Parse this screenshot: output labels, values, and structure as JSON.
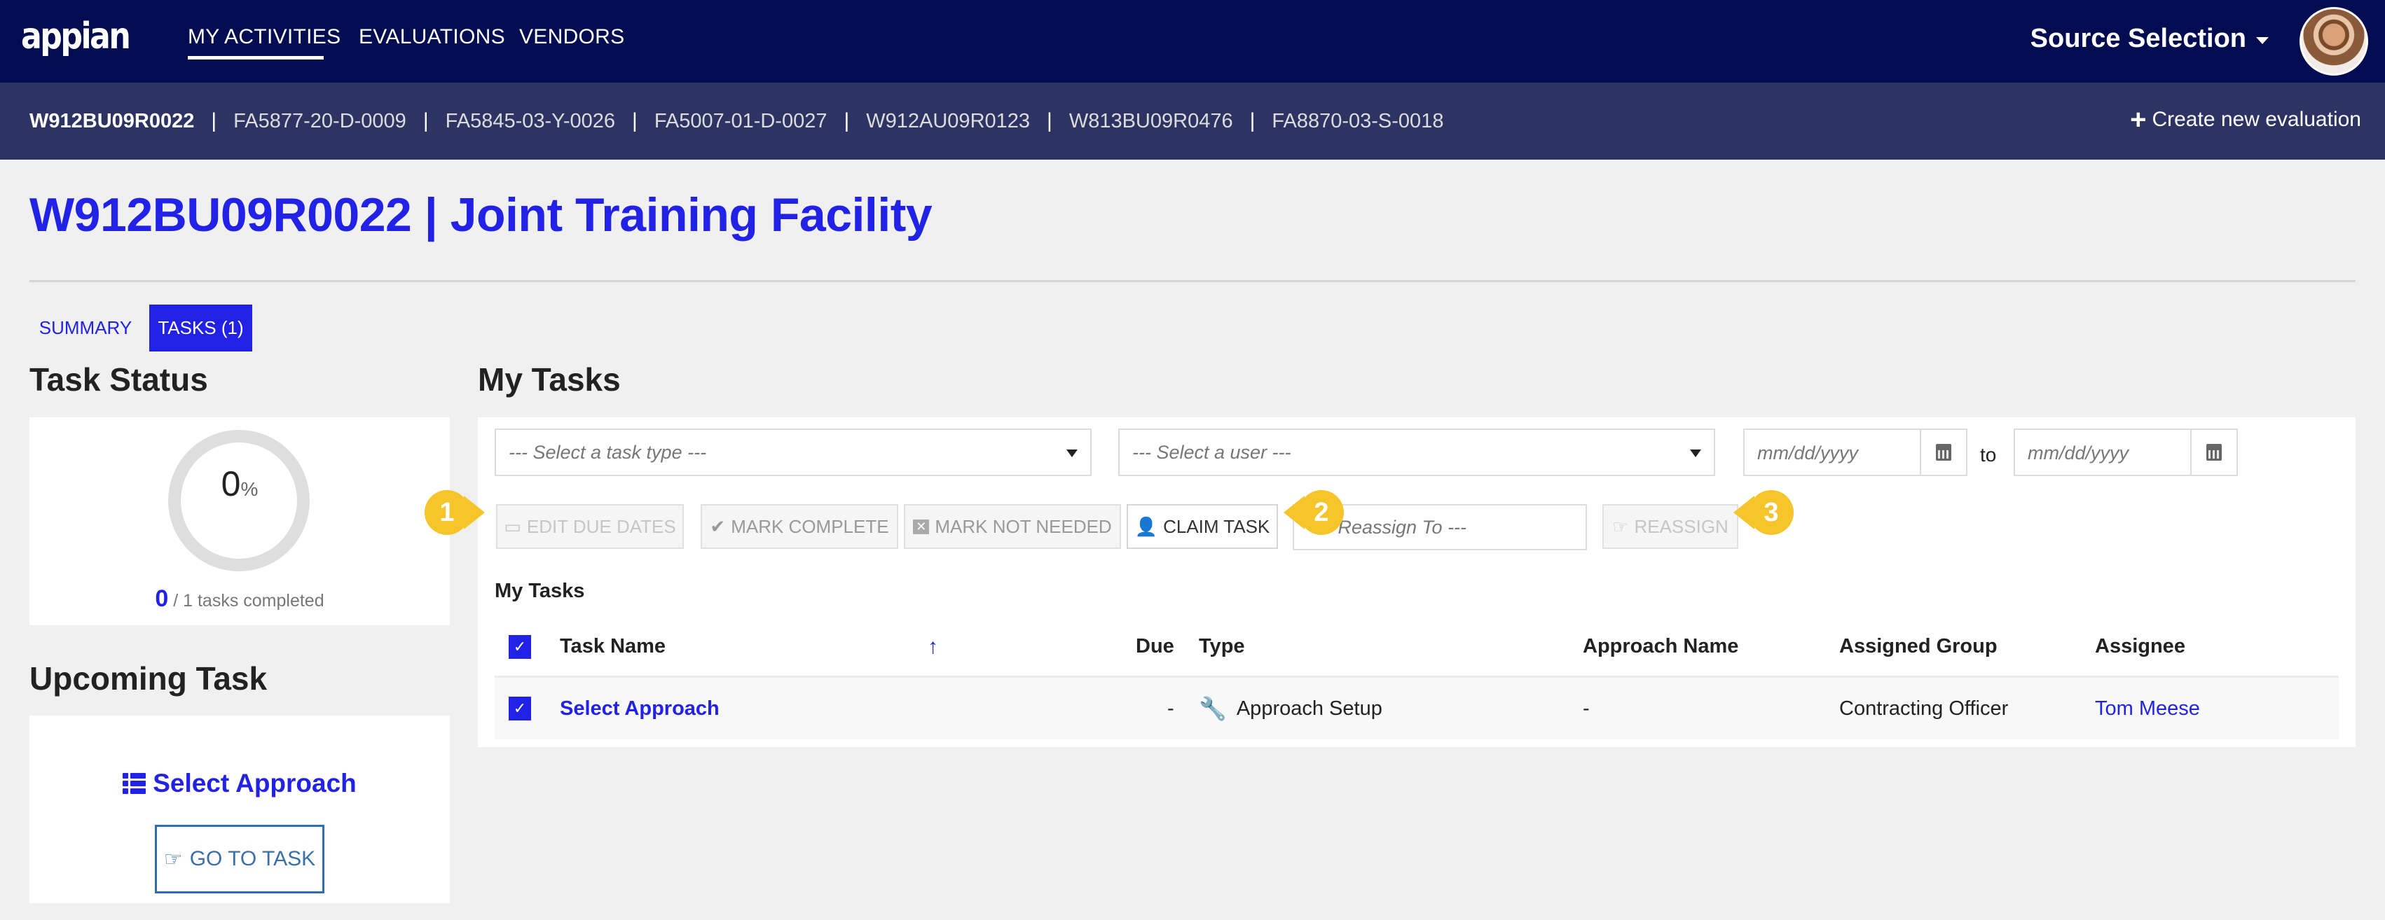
{
  "topnav": {
    "logo": "appian",
    "links": [
      "MY ACTIVITIES",
      "EVALUATIONS",
      "VENDORS"
    ],
    "active_link": "MY ACTIVITIES",
    "app_switcher": "Source Selection",
    "avatar_alt": "user-avatar"
  },
  "subnav": {
    "evaluations": [
      "W912BU09R0022",
      "FA5877-20-D-0009",
      "FA5845-03-Y-0026",
      "FA5007-01-D-0027",
      "W912AU09R0123",
      "W813BU09R0476",
      "FA8870-03-S-0018"
    ],
    "current": "W912BU09R0022",
    "separator": "|",
    "create_new": "Create new evaluation"
  },
  "page": {
    "title": "W912BU09R0022 | Joint Training Facility",
    "tabs": [
      {
        "label": "SUMMARY",
        "active": false
      },
      {
        "label": "TASKS (1)",
        "active": true
      }
    ]
  },
  "task_status": {
    "heading": "Task Status",
    "percent_value": "0",
    "percent_sign": "%",
    "progress_fraction": 0,
    "completed": "0",
    "caption": "/ 1 tasks completed"
  },
  "upcoming_task": {
    "heading": "Upcoming Task",
    "task_name": "Select Approach",
    "go_button": "GO TO TASK"
  },
  "my_tasks": {
    "heading": "My Tasks",
    "filters": {
      "task_type_placeholder": "--- Select a task type ---",
      "user_placeholder": "--- Select a user ---",
      "date_from_placeholder": "mm/dd/yyyy",
      "date_to_placeholder": "mm/dd/yyyy",
      "to_label": "to"
    },
    "actions": {
      "edit_due_dates": "EDIT DUE DATES",
      "mark_complete": "MARK COMPLETE",
      "mark_not_needed": "MARK NOT NEEDED",
      "claim_task": "CLAIM TASK",
      "reassign_placeholder": "--- Reassign To ---",
      "reassign": "REASSIGN"
    },
    "callouts": [
      "1",
      "2",
      "3"
    ],
    "table": {
      "caption": "My Tasks",
      "columns": [
        "Task Name",
        "Due",
        "Type",
        "Approach Name",
        "Assigned Group",
        "Assignee"
      ],
      "sort_indicator": "↑",
      "rows": [
        {
          "checked": true,
          "task_name": "Select Approach",
          "due": "-",
          "type": "Approach Setup",
          "approach_name": "-",
          "assigned_group": "Contracting Officer",
          "assignee": "Tom Meese"
        }
      ]
    }
  },
  "colors": {
    "primary": "#2222e6",
    "topnav_bg": "#020c50",
    "subnav_bg": "#2d3464",
    "callout": "#f5c52b",
    "page_bg": "#f0f0f0"
  }
}
